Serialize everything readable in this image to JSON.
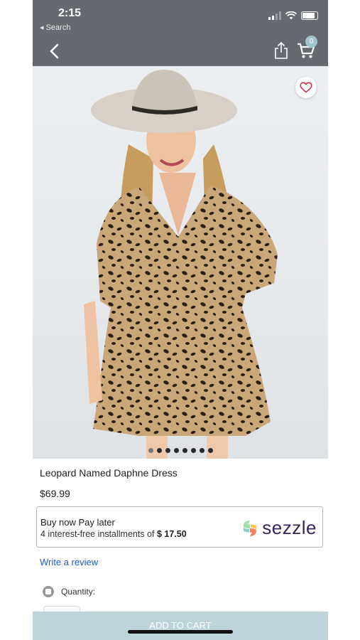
{
  "status_bar": {
    "time": "2:15",
    "back_label": "◂ Search"
  },
  "header": {
    "cart_count": "0"
  },
  "product": {
    "title": "Leopard Named Daphne Dress",
    "price": "$69.99",
    "image_count": 8,
    "active_image": 0
  },
  "sezzle": {
    "headline": "Buy now Pay later",
    "installments_prefix": "4 interest-free installments of ",
    "installment_amount": "$ 17.50",
    "brand": "sezzle"
  },
  "review_link": "Write a review",
  "quantity_label": "Quantity:",
  "add_to_cart_label": "ADD TO CART",
  "colors": {
    "header_bg": "#666a70",
    "cart_badge": "#9fc6cf",
    "button_bg": "#bcd4da",
    "link": "#1d5cc6",
    "heart": "#d0314a"
  }
}
